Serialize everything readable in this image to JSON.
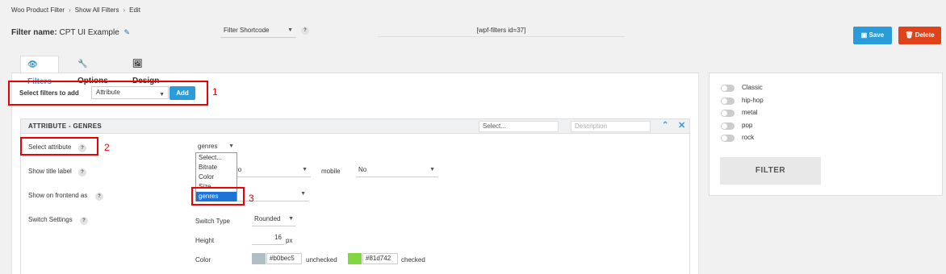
{
  "breadcrumb": {
    "items": [
      "Woo Product Filter",
      "Show All Filters",
      "Edit"
    ]
  },
  "header": {
    "filter_name_label": "Filter name:",
    "filter_name_value": "CPT UI Example",
    "shortcode_select": "Filter Shortcode",
    "shortcode_value": "[wpf-filters id=37]",
    "save_label": "Save",
    "delete_label": "Delete"
  },
  "tabs": [
    {
      "label": "Filters",
      "icon": "eye-icon",
      "active": true
    },
    {
      "label": "Options",
      "icon": "wrench-icon",
      "active": false
    },
    {
      "label": "Design",
      "icon": "image-icon",
      "active": false
    }
  ],
  "add_filter": {
    "label": "Select filters to add",
    "selected": "Attribute",
    "add_label": "Add"
  },
  "annotations": [
    "1",
    "2",
    "3"
  ],
  "panel": {
    "title": "ATTRIBUTE - GENRES",
    "select_placeholder": "Select...",
    "description_placeholder": "Description",
    "rows": {
      "select_attribute": {
        "label": "Select attribute",
        "value": "genres"
      },
      "show_title_label": {
        "label": "Show title label",
        "value": "No",
        "mobile_label": "mobile",
        "mobile_value": "No"
      },
      "show_on_frontend": {
        "label": "Show on frontend as"
      },
      "switch_settings": {
        "label": "Switch Settings",
        "switch_type_label": "Switch Type",
        "switch_type_value": "Rounded",
        "height_label": "Height",
        "height_value": "16",
        "height_unit": "px",
        "color_label": "Color",
        "unchecked_color": "#b0bec5",
        "unchecked_label": "unchecked",
        "checked_color": "#81d742",
        "checked_label": "checked"
      }
    },
    "dropdown_options": [
      "Select...",
      "Bitrate",
      "Color",
      "Size",
      "genres"
    ]
  },
  "preview": {
    "items": [
      "Classic",
      "hip-hop",
      "metal",
      "pop",
      "rock"
    ],
    "filter_button": "FILTER"
  },
  "colors": {
    "accent": "#2a9cda",
    "delete": "#e0421b",
    "annotation": "#ee0000"
  }
}
